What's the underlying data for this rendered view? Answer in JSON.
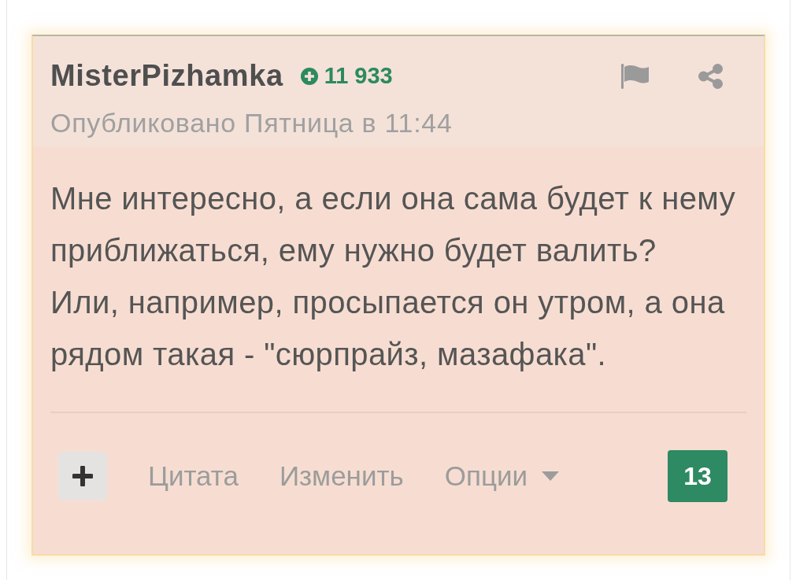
{
  "post": {
    "author": "MisterPizhamka",
    "reputation": {
      "value": "11 933",
      "positive": true
    },
    "published": "Опубликовано Пятница в 11:44",
    "body": [
      "Мне интересно, а если она сама будет к нему приближаться, ему нужно будет валить?",
      "Или, например, просыпается он утром, а она рядом такая - \"сюрпрайз, мазафака\"."
    ],
    "actions": [
      {
        "label": "Цитата",
        "kind": "link"
      },
      {
        "label": "Изменить",
        "kind": "link"
      },
      {
        "label": "Опции",
        "kind": "dropdown"
      }
    ],
    "votes": "13"
  }
}
